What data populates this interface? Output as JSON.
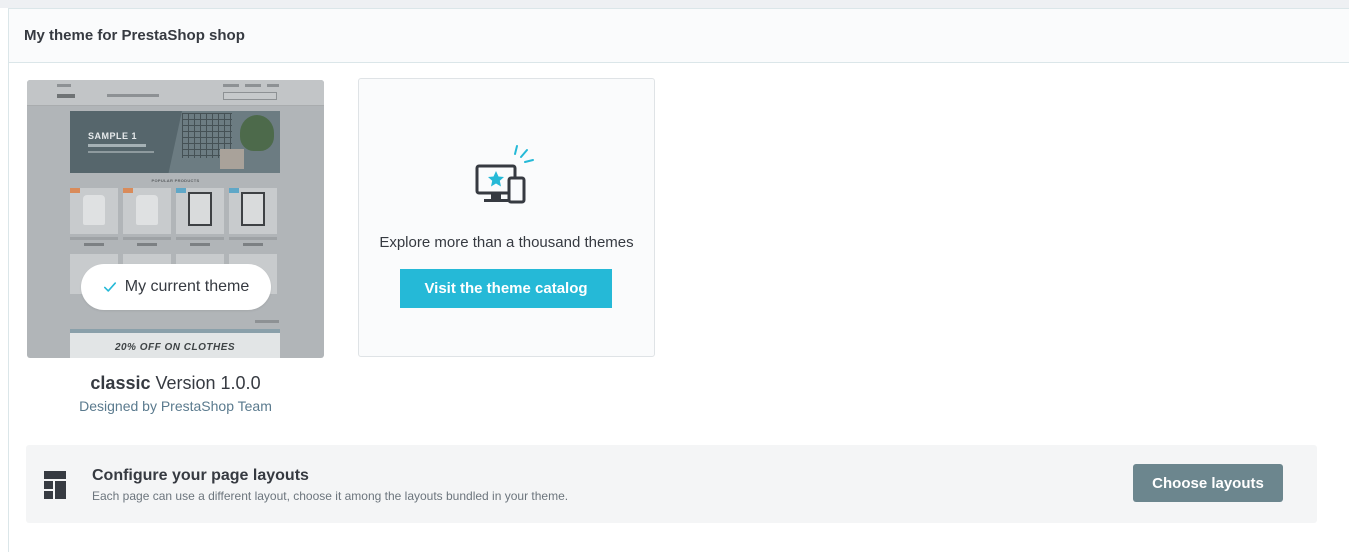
{
  "panel": {
    "title": "My theme for PrestaShop shop"
  },
  "current_theme": {
    "badge_label": "My current theme",
    "name": "classic",
    "version_label": "Version 1.0.0",
    "author": "Designed by PrestaShop Team",
    "preview": {
      "banner_title": "SAMPLE 1",
      "section_title": "POPULAR PRODUCTS",
      "promo_label": "20% OFF ON CLOTHES"
    }
  },
  "catalog": {
    "icon": "monitor-star-icon",
    "description": "Explore more than a thousand themes",
    "button_label": "Visit the theme catalog"
  },
  "layouts": {
    "icon": "layout-grid-icon",
    "title": "Configure your page layouts",
    "description": "Each page can use a different layout, choose it among the layouts bundled in your theme.",
    "button_label": "Choose layouts"
  },
  "colors": {
    "primary": "#25b9d7",
    "secondary": "#6c868e",
    "link": "#5a7a8e",
    "text": "#363a41"
  }
}
